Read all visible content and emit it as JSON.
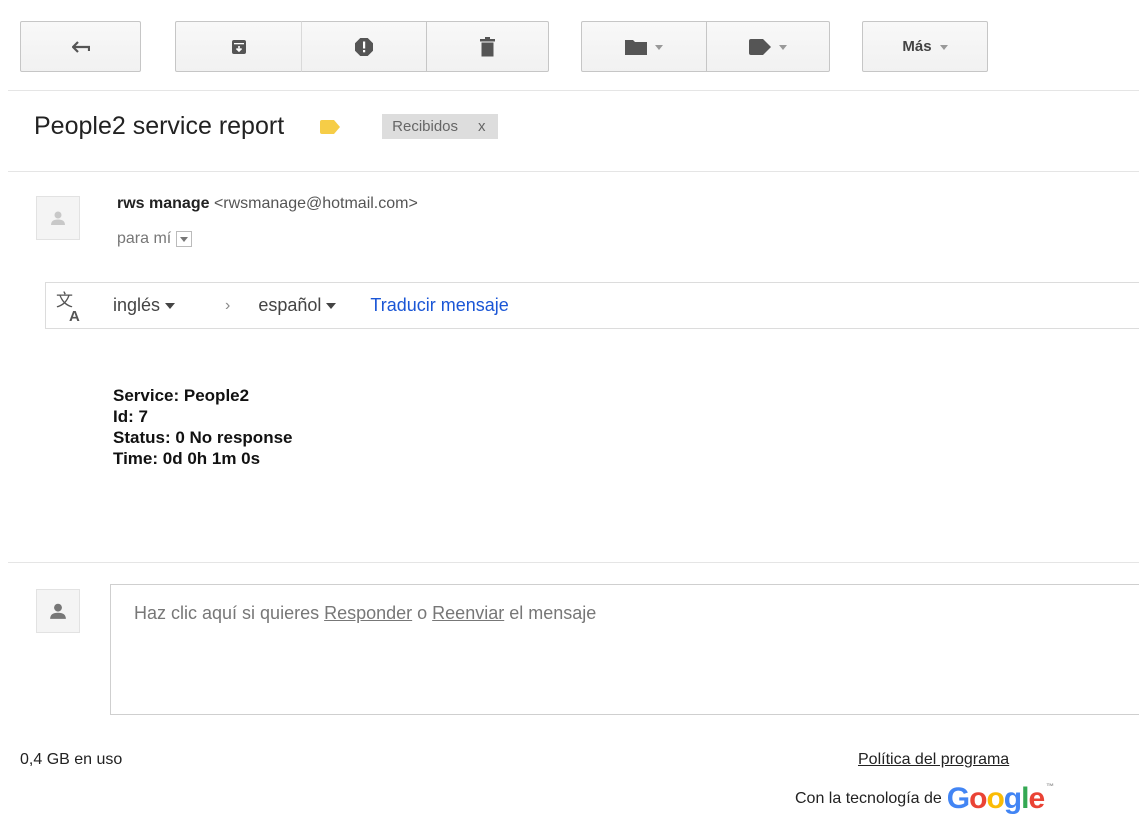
{
  "toolbar": {
    "more_label": "Más"
  },
  "email": {
    "subject": "People2 service report",
    "label_chip": "Recibidos",
    "label_chip_remove": "x",
    "sender_name": "rws manage",
    "sender_email": "<rwsmanage@hotmail.com>",
    "to_label": "para mí"
  },
  "translate": {
    "from_lang": "inglés",
    "separator": "›",
    "to_lang": "español",
    "action": "Traducir mensaje"
  },
  "body": {
    "lines": [
      "Service: People2",
      "Id: 7",
      "Status: 0 No response",
      "Time: 0d 0h 1m 0s"
    ]
  },
  "reply": {
    "prefix": "Haz clic aquí si quieres ",
    "reply_link": "Responder",
    "middle": " o ",
    "forward_link": "Reenviar",
    "suffix": " el mensaje"
  },
  "footer": {
    "usage": "0,4 GB en uso",
    "policy": "Política del programa",
    "powered_by": "Con la tecnología de",
    "brand": "Google",
    "brand_tm": "™"
  },
  "colors": {
    "label_yellow": "#f6cd47",
    "link_blue": "#1a56d6",
    "g_blue": "#4285f4",
    "g_red": "#ea4335",
    "g_yellow": "#fbbc05",
    "g_green": "#34a853"
  }
}
